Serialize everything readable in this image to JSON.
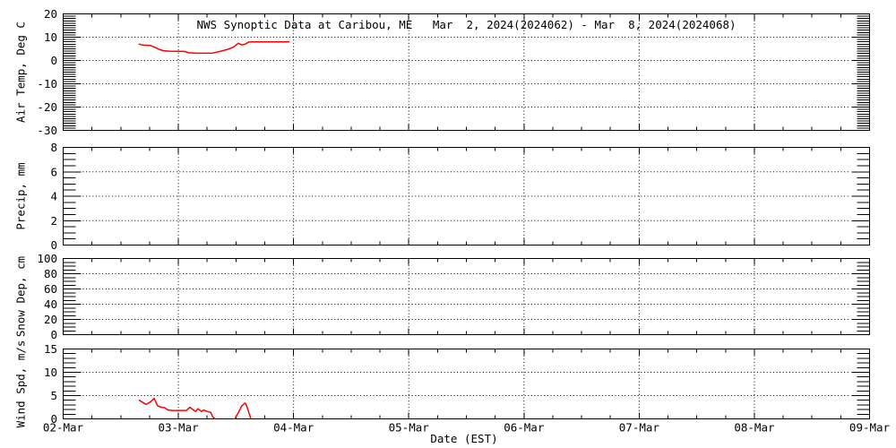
{
  "chart": {
    "title": "NWS Synoptic Data at Caribou, ME   Mar  2, 2024(2024062) - Mar  8, 2024(2024068)",
    "xlabel": "Date (EST)",
    "colors": {
      "series": "#ff0000",
      "axis": "#000000",
      "background": "#ffffff"
    },
    "x_axis": {
      "unit": "days since 02-Mar-2024 00:00 EST",
      "range_days": [
        0,
        7
      ],
      "major_tick_step_days": 1,
      "minor_tick_step_days": 0.25,
      "grid_days": [
        1,
        2,
        3,
        4,
        5,
        6
      ],
      "tick_labels": [
        "02-Mar",
        "03-Mar",
        "04-Mar",
        "05-Mar",
        "06-Mar",
        "07-Mar",
        "08-Mar",
        "09-Mar"
      ]
    },
    "chart_data": [
      {
        "type": "line",
        "id": "air-temp",
        "ylabel": "Air Temp, Deg C",
        "ylim": [
          -30,
          20
        ],
        "yticks": [
          -30,
          -20,
          -10,
          0,
          10,
          20
        ],
        "minor_tick_step": 1,
        "grid": true,
        "series": [
          {
            "name": "air-temp-trace",
            "color": "#ff0000",
            "points": [
              [
                0.66,
                7.0
              ],
              [
                0.69,
                6.6
              ],
              [
                0.73,
                6.5
              ],
              [
                0.76,
                6.4
              ],
              [
                0.79,
                5.8
              ],
              [
                0.83,
                4.8
              ],
              [
                0.87,
                4.2
              ],
              [
                0.92,
                4.0
              ],
              [
                1.05,
                3.9
              ],
              [
                1.09,
                3.3
              ],
              [
                1.16,
                3.1
              ],
              [
                1.3,
                3.2
              ],
              [
                1.37,
                4.0
              ],
              [
                1.43,
                4.8
              ],
              [
                1.48,
                5.8
              ],
              [
                1.52,
                7.4
              ],
              [
                1.55,
                6.7
              ],
              [
                1.58,
                7.0
              ],
              [
                1.61,
                7.9
              ],
              [
                1.64,
                8.0
              ],
              [
                1.96,
                8.0
              ]
            ]
          }
        ]
      },
      {
        "type": "line",
        "id": "precip",
        "ylabel": "Precip, mm",
        "ylim": [
          0,
          8
        ],
        "yticks": [
          0,
          2,
          4,
          6,
          8
        ],
        "minor_tick_step": 0.5,
        "grid": true,
        "series": []
      },
      {
        "type": "line",
        "id": "snow-depth",
        "ylabel": "Snow Dep, cm",
        "ylim": [
          0,
          100
        ],
        "yticks": [
          0,
          20,
          40,
          60,
          80,
          100
        ],
        "minor_tick_step": 5,
        "grid": true,
        "series": []
      },
      {
        "type": "line",
        "id": "wind-speed",
        "ylabel": "Wind Spd, m/s",
        "ylim": [
          0,
          15
        ],
        "yticks": [
          0,
          5,
          10,
          15
        ],
        "minor_tick_step": 1,
        "grid": true,
        "series": [
          {
            "name": "wind-speed-trace-1",
            "color": "#ff0000",
            "points": [
              [
                0.66,
                4.0
              ],
              [
                0.7,
                3.4
              ],
              [
                0.72,
                3.1
              ],
              [
                0.76,
                3.7
              ],
              [
                0.79,
                4.4
              ],
              [
                0.82,
                2.8
              ],
              [
                0.85,
                2.5
              ],
              [
                0.88,
                2.4
              ],
              [
                0.91,
                1.9
              ],
              [
                0.95,
                1.8
              ],
              [
                1.0,
                1.8
              ],
              [
                1.07,
                1.8
              ],
              [
                1.1,
                2.5
              ],
              [
                1.13,
                1.9
              ],
              [
                1.15,
                1.6
              ],
              [
                1.17,
                2.2
              ],
              [
                1.2,
                1.6
              ],
              [
                1.22,
                1.9
              ],
              [
                1.25,
                1.6
              ],
              [
                1.28,
                1.4
              ],
              [
                1.3,
                0.4
              ],
              [
                1.32,
                0.0
              ]
            ]
          },
          {
            "name": "wind-speed-trace-2",
            "color": "#ff0000",
            "points": [
              [
                1.49,
                0.0
              ],
              [
                1.52,
                1.3
              ],
              [
                1.55,
                2.8
              ],
              [
                1.58,
                3.4
              ],
              [
                1.59,
                3.0
              ],
              [
                1.61,
                1.5
              ],
              [
                1.63,
                0.0
              ]
            ]
          }
        ]
      }
    ]
  }
}
